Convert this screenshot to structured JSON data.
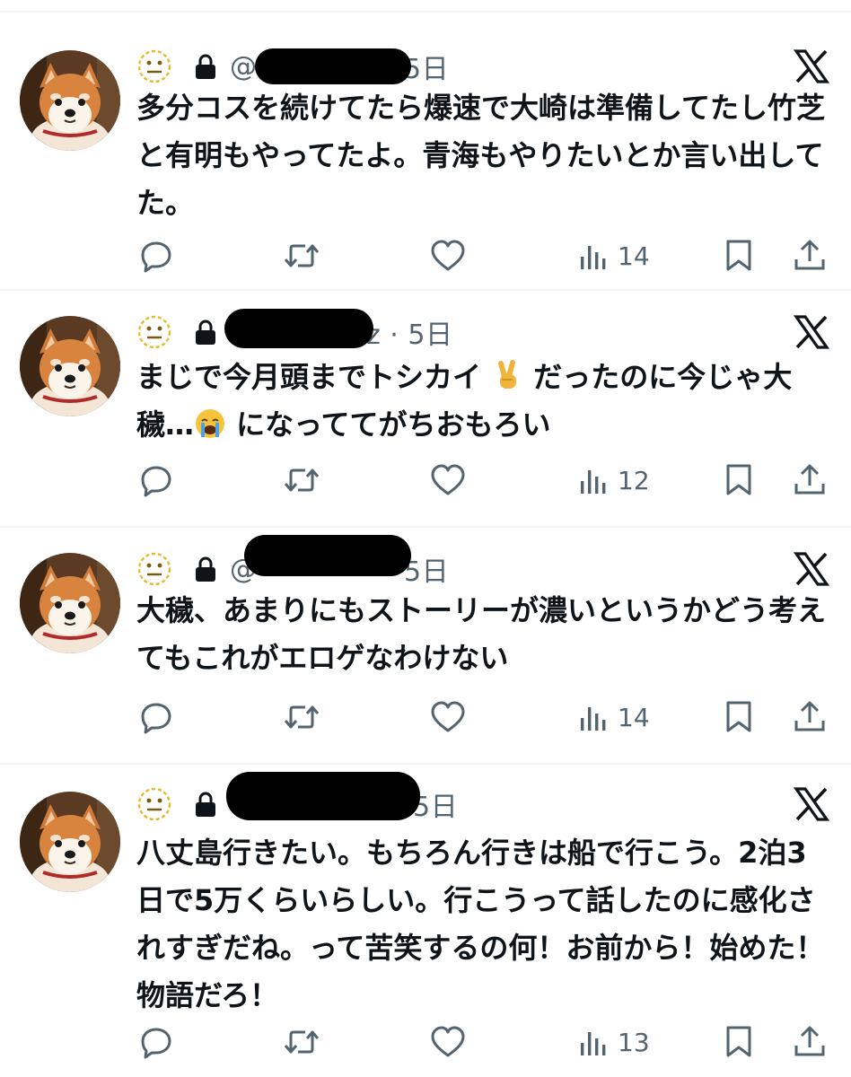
{
  "colors": {
    "text": "#0f1419",
    "muted": "#536471",
    "divider": "#eff3f4"
  },
  "tweets": [
    {
      "handle_left": "@",
      "handle_right": "5日",
      "text": "多分コスを続けてたら爆速で大崎は準備してたし竹芝と有明もやってたよ。青海もやりたいとか言い出してた。",
      "views": "14"
    },
    {
      "handle_left": "",
      "handle_right": "z · 5日",
      "text_before": "まじで今月頭までトシカイ",
      "text_middle": "だったのに今じゃ大穢…",
      "text_after": "になっててがちおもろい",
      "emoji_1": "victory-hand-emoji",
      "emoji_2": "crying-face-emoji",
      "views": "12"
    },
    {
      "handle_left": "@",
      "handle_right": "5日",
      "text": "大穢、あまりにもストーリーが濃いというかどう考えてもこれがエロゲなわけない",
      "views": "14"
    },
    {
      "handle_left": "",
      "handle_right": "5日",
      "text": "八丈島行きたい。もちろん行きは船で行こう。2泊3日で5万くらいらしい。行こうって話したのに感化されすぎだね。って苦笑するの何！お前から！始めた！物語だろ！",
      "views": "13"
    }
  ],
  "icons": {
    "avatar": "shiba-dog-avatar",
    "status": "neutral-face-icon",
    "lock": "lock-icon",
    "platform": "x-logo-icon",
    "reply": "reply-icon",
    "retweet": "retweet-icon",
    "like": "heart-icon",
    "views": "views-icon",
    "bookmark": "bookmark-icon",
    "share": "share-icon"
  }
}
